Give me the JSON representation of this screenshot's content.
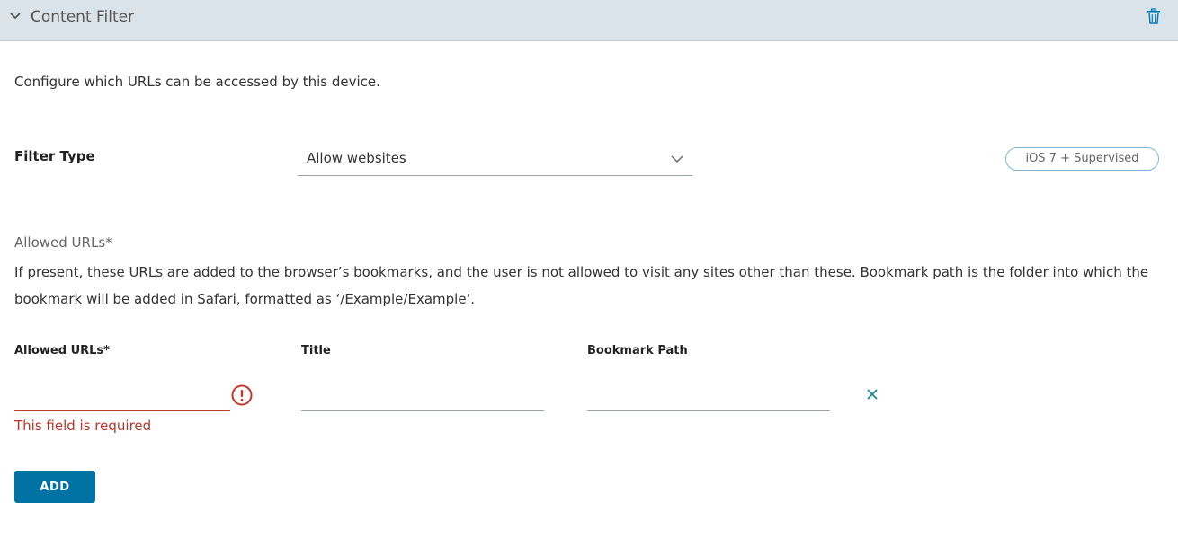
{
  "section": {
    "title": "Content Filter",
    "collapse_icon": "chevron-down-icon",
    "delete_icon": "trash-icon"
  },
  "description": "Configure which URLs can be accessed by this device.",
  "filter_type": {
    "label": "Filter Type",
    "selected": "Allow websites",
    "badge": "iOS 7 + Supervised"
  },
  "allowed_urls": {
    "heading": "Allowed URLs*",
    "help": "If present, these URLs are added to the browser’s bookmarks, and the user is not allowed to visit any sites other than these. Bookmark path is the folder into which the bookmark will be added in Safari, formatted as ‘/Example/Example’.",
    "columns": {
      "url": "Allowed URLs*",
      "title": "Title",
      "bookmark_path": "Bookmark Path"
    },
    "row": {
      "url": "",
      "title": "",
      "bookmark_path": "",
      "error": "This field is required"
    },
    "add_label": "ADD"
  },
  "colors": {
    "header_bg": "#dbe3ea",
    "accent": "#0072a3",
    "error": "#b5382a"
  }
}
